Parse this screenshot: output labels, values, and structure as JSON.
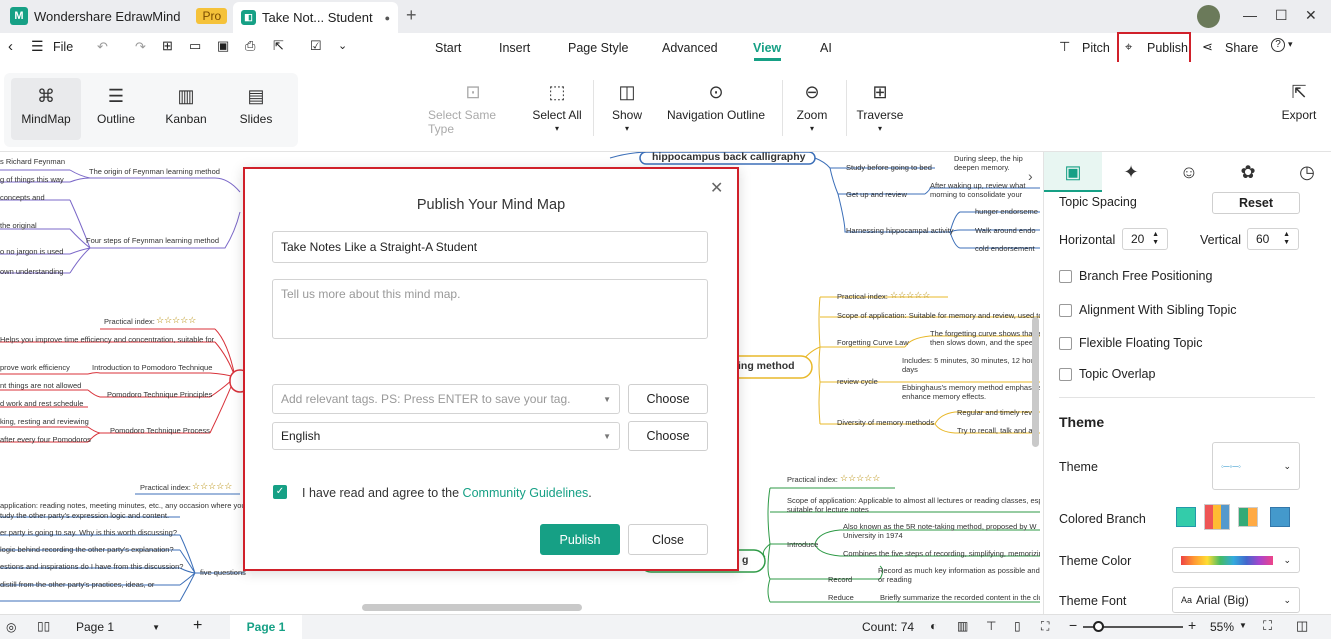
{
  "app": {
    "name": "Wondershare EdrawMind",
    "badge": "Pro",
    "doc_tab": "Take Not... Student"
  },
  "window": {
    "min": "—",
    "max": "☐",
    "close": "✕"
  },
  "menu": {
    "file": "File",
    "tabs": [
      "Start",
      "Insert",
      "Page Style",
      "Advanced",
      "View",
      "AI"
    ],
    "pitch": "Pitch",
    "publish": "Publish",
    "share": "Share",
    "help": "?"
  },
  "ribbon": {
    "views": [
      "MindMap",
      "Outline",
      "Kanban",
      "Slides"
    ],
    "buttons": [
      "Select Same Type",
      "Select All",
      "Show",
      "Navigation Outline",
      "Zoom",
      "Traverse"
    ],
    "export": "Export"
  },
  "canvas": {
    "left_nodes": [
      "s Richard Feynman",
      "g of things this way",
      "concepts and",
      "the original",
      "o no jargon is used",
      "own understanding",
      "The origin of Feynman learning method",
      "Four steps of Feynman learning method",
      "Practical index:",
      "Helps you improve time efficiency and concentration, suitable for",
      "prove work efficiency",
      "nt things are not allowed",
      "d work and rest schedule",
      "king, resting and reviewing",
      "after every four Pomodoros",
      "Introduction to Pomodoro Technique",
      "Pomodoro Technique Principles",
      "Pomodoro Technique Process",
      "Practical index:",
      "application: reading notes, meeting minutes, etc., any occasion where you",
      "tudy the other party's expression logic and content.",
      "er party is going to say. Why is this worth discussing?",
      "logic behind recording the other party's explanation?",
      "estions and inspirations do I have from this discussion?",
      "distill from the other party's practices, ideas, or",
      "five questions"
    ],
    "right_nodes": [
      "hippocampus back calligraphy",
      "Study before going to bed",
      "During sleep, the hip",
      "deepen memory.",
      "Get up and review",
      "After waking up, review what",
      "morning to consolidate your",
      "Harnessing hippocampal activity",
      "hunger endorseme",
      "Walk around endo",
      "cold endorsement",
      "ing method",
      "Practical index:",
      "Scope of application: Suitable for memory and review, used to",
      "Forgetting Curve Law",
      "The forgetting curve shows that a",
      "then slows down, and the speed",
      "Includes: 5 minutes, 30 minutes, 12 hou",
      "days",
      "review cycle",
      "Ebbinghaus's memory method emphasize",
      "enhance memory effects.",
      "Diversity of memory methods",
      "Regular and timely revie",
      "Try to recall, talk and a",
      "g",
      "Practical index:",
      "Scope of application: Applicable to almost all lectures or reading classes, esp",
      "suitable for lecture notes",
      "Also known as the 5R note-taking method, proposed by W",
      "University in 1974",
      "Introduce",
      "Combines the five steps of recording, simplifying, memorizin",
      "Record as much key information as possible and",
      "or reading",
      "Record",
      "Reduce",
      "Briefly summarize the recorded content in the clu"
    ],
    "stars": "☆☆☆☆☆"
  },
  "panel": {
    "topic_spacing": "Topic Spacing",
    "reset": "Reset",
    "horizontal_label": "Horizontal",
    "horizontal_value": "20",
    "vertical_label": "Vertical",
    "vertical_value": "60",
    "checks": [
      "Branch Free Positioning",
      "Alignment With Sibling Topic",
      "Flexible Floating Topic",
      "Topic Overlap"
    ],
    "theme_heading": "Theme",
    "theme_label": "Theme",
    "colored_branch": "Colored Branch",
    "theme_color": "Theme Color",
    "theme_font": "Theme Font",
    "font_value": "Arial (Big)"
  },
  "dialog": {
    "title": "Publish Your Mind Map",
    "name_value": "Take Notes Like a Straight-A Student",
    "desc_placeholder": "Tell us more about this mind map.",
    "tags_placeholder": "Add relevant tags. PS: Press ENTER to save your tag.",
    "choose1": "Choose",
    "language": "English",
    "choose2": "Choose",
    "agree_text": "I have read and agree to the",
    "guidelines": "Community Guidelines",
    "period": ".",
    "publish": "Publish",
    "close": "Close"
  },
  "status": {
    "page_select": "Page 1",
    "page_tab": "Page 1",
    "count": "Count: 74",
    "zoom": "55%"
  },
  "colors": {
    "accent": "#16a085",
    "highlight": "#d0202a",
    "purple": "#7b68c8",
    "red": "#d8323a",
    "yellow": "#e8b82a",
    "green": "#2e9a46",
    "blue": "#3c6fb8"
  }
}
